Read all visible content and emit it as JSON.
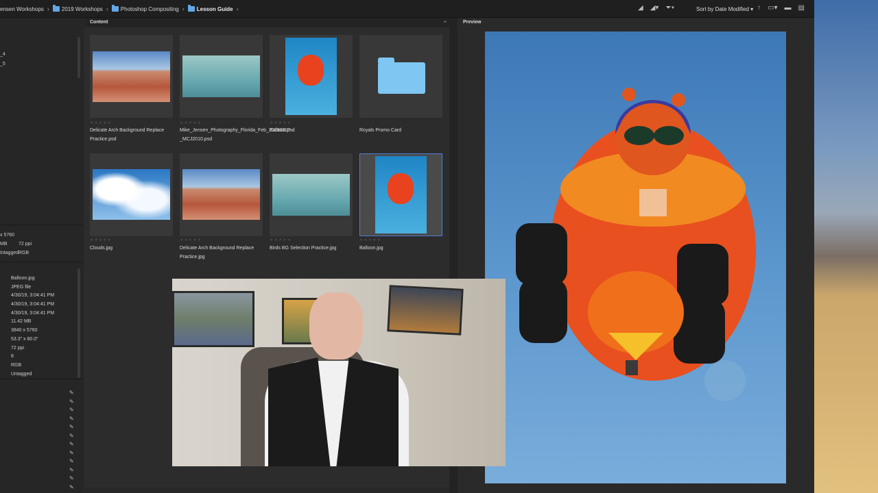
{
  "breadcrumb": [
    "ensen Workshops",
    "2019 Workshops",
    "Photoshop Compositing",
    "Lesson Guide"
  ],
  "toolbar": {
    "sort_label": "Sort by Date Modified"
  },
  "left_panel": {
    "top_items": [
      "_4",
      "_5"
    ],
    "file_props": [
      "x 5760",
      "MB",
      "72 ppi",
      "Intagged",
      "RGB"
    ],
    "metadata": [
      "Balloon.jpg",
      "JPEG file",
      "4/30/19, 3:04:41 PM",
      "4/30/19, 3:04:41 PM",
      "4/30/19, 3:04:41 PM",
      "11.42 MB",
      "3840 x 5760",
      "53.3\" x 80.0\"",
      "72 ppi",
      "8",
      "RGB",
      "Untagged"
    ]
  },
  "content": {
    "tab": "Content",
    "items": [
      {
        "label": "Delicate Arch Background Replace Practice.psd",
        "kind": "arch"
      },
      {
        "label": "Mike_Jensen_Photography_Florida_Feb_20190307-_MCJ2010.psd",
        "kind": "birds"
      },
      {
        "label": "Balloon.psd",
        "kind": "balloon"
      },
      {
        "label": "Royals Promo Card",
        "kind": "folder"
      },
      {
        "label": "Clouds.jpg",
        "kind": "clouds"
      },
      {
        "label": "Delicate Arch Background Replace Practice.jpg",
        "kind": "arch"
      },
      {
        "label": "Birds BG Selection Practice.jpg",
        "kind": "birds"
      },
      {
        "label": "Balloon.jpg",
        "kind": "balloon",
        "selected": true
      }
    ]
  },
  "preview": {
    "tab": "Preview"
  }
}
